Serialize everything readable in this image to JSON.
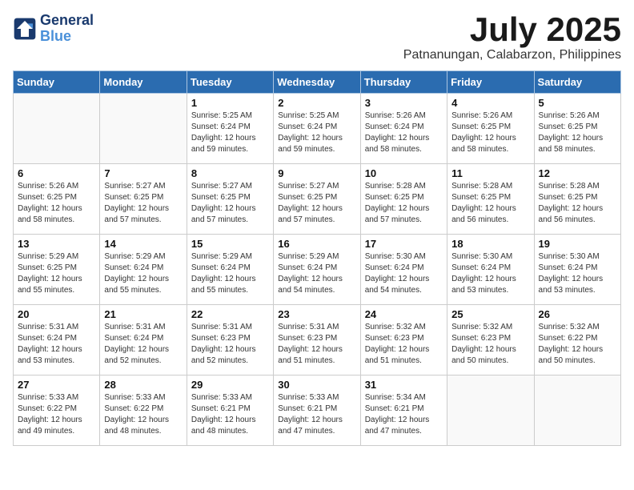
{
  "header": {
    "logo_line1": "General",
    "logo_line2": "Blue",
    "month": "July 2025",
    "location": "Patnanungan, Calabarzon, Philippines"
  },
  "weekdays": [
    "Sunday",
    "Monday",
    "Tuesday",
    "Wednesday",
    "Thursday",
    "Friday",
    "Saturday"
  ],
  "weeks": [
    [
      {
        "day": "",
        "info": ""
      },
      {
        "day": "",
        "info": ""
      },
      {
        "day": "1",
        "info": "Sunrise: 5:25 AM\nSunset: 6:24 PM\nDaylight: 12 hours and 59 minutes."
      },
      {
        "day": "2",
        "info": "Sunrise: 5:25 AM\nSunset: 6:24 PM\nDaylight: 12 hours and 59 minutes."
      },
      {
        "day": "3",
        "info": "Sunrise: 5:26 AM\nSunset: 6:24 PM\nDaylight: 12 hours and 58 minutes."
      },
      {
        "day": "4",
        "info": "Sunrise: 5:26 AM\nSunset: 6:25 PM\nDaylight: 12 hours and 58 minutes."
      },
      {
        "day": "5",
        "info": "Sunrise: 5:26 AM\nSunset: 6:25 PM\nDaylight: 12 hours and 58 minutes."
      }
    ],
    [
      {
        "day": "6",
        "info": "Sunrise: 5:26 AM\nSunset: 6:25 PM\nDaylight: 12 hours and 58 minutes."
      },
      {
        "day": "7",
        "info": "Sunrise: 5:27 AM\nSunset: 6:25 PM\nDaylight: 12 hours and 57 minutes."
      },
      {
        "day": "8",
        "info": "Sunrise: 5:27 AM\nSunset: 6:25 PM\nDaylight: 12 hours and 57 minutes."
      },
      {
        "day": "9",
        "info": "Sunrise: 5:27 AM\nSunset: 6:25 PM\nDaylight: 12 hours and 57 minutes."
      },
      {
        "day": "10",
        "info": "Sunrise: 5:28 AM\nSunset: 6:25 PM\nDaylight: 12 hours and 57 minutes."
      },
      {
        "day": "11",
        "info": "Sunrise: 5:28 AM\nSunset: 6:25 PM\nDaylight: 12 hours and 56 minutes."
      },
      {
        "day": "12",
        "info": "Sunrise: 5:28 AM\nSunset: 6:25 PM\nDaylight: 12 hours and 56 minutes."
      }
    ],
    [
      {
        "day": "13",
        "info": "Sunrise: 5:29 AM\nSunset: 6:25 PM\nDaylight: 12 hours and 55 minutes."
      },
      {
        "day": "14",
        "info": "Sunrise: 5:29 AM\nSunset: 6:24 PM\nDaylight: 12 hours and 55 minutes."
      },
      {
        "day": "15",
        "info": "Sunrise: 5:29 AM\nSunset: 6:24 PM\nDaylight: 12 hours and 55 minutes."
      },
      {
        "day": "16",
        "info": "Sunrise: 5:29 AM\nSunset: 6:24 PM\nDaylight: 12 hours and 54 minutes."
      },
      {
        "day": "17",
        "info": "Sunrise: 5:30 AM\nSunset: 6:24 PM\nDaylight: 12 hours and 54 minutes."
      },
      {
        "day": "18",
        "info": "Sunrise: 5:30 AM\nSunset: 6:24 PM\nDaylight: 12 hours and 53 minutes."
      },
      {
        "day": "19",
        "info": "Sunrise: 5:30 AM\nSunset: 6:24 PM\nDaylight: 12 hours and 53 minutes."
      }
    ],
    [
      {
        "day": "20",
        "info": "Sunrise: 5:31 AM\nSunset: 6:24 PM\nDaylight: 12 hours and 53 minutes."
      },
      {
        "day": "21",
        "info": "Sunrise: 5:31 AM\nSunset: 6:24 PM\nDaylight: 12 hours and 52 minutes."
      },
      {
        "day": "22",
        "info": "Sunrise: 5:31 AM\nSunset: 6:23 PM\nDaylight: 12 hours and 52 minutes."
      },
      {
        "day": "23",
        "info": "Sunrise: 5:31 AM\nSunset: 6:23 PM\nDaylight: 12 hours and 51 minutes."
      },
      {
        "day": "24",
        "info": "Sunrise: 5:32 AM\nSunset: 6:23 PM\nDaylight: 12 hours and 51 minutes."
      },
      {
        "day": "25",
        "info": "Sunrise: 5:32 AM\nSunset: 6:23 PM\nDaylight: 12 hours and 50 minutes."
      },
      {
        "day": "26",
        "info": "Sunrise: 5:32 AM\nSunset: 6:22 PM\nDaylight: 12 hours and 50 minutes."
      }
    ],
    [
      {
        "day": "27",
        "info": "Sunrise: 5:33 AM\nSunset: 6:22 PM\nDaylight: 12 hours and 49 minutes."
      },
      {
        "day": "28",
        "info": "Sunrise: 5:33 AM\nSunset: 6:22 PM\nDaylight: 12 hours and 48 minutes."
      },
      {
        "day": "29",
        "info": "Sunrise: 5:33 AM\nSunset: 6:21 PM\nDaylight: 12 hours and 48 minutes."
      },
      {
        "day": "30",
        "info": "Sunrise: 5:33 AM\nSunset: 6:21 PM\nDaylight: 12 hours and 47 minutes."
      },
      {
        "day": "31",
        "info": "Sunrise: 5:34 AM\nSunset: 6:21 PM\nDaylight: 12 hours and 47 minutes."
      },
      {
        "day": "",
        "info": ""
      },
      {
        "day": "",
        "info": ""
      }
    ]
  ]
}
